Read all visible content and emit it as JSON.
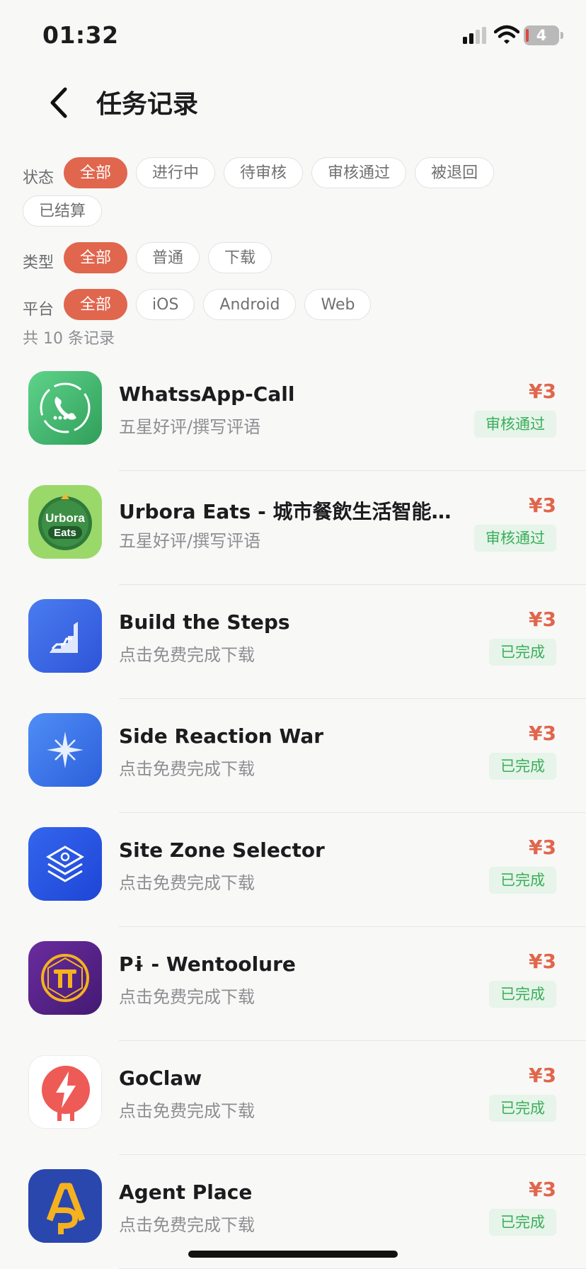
{
  "status_bar": {
    "time": "01:32",
    "battery": "4"
  },
  "nav": {
    "title": "任务记录"
  },
  "filters": {
    "status": {
      "label": "状态",
      "options": [
        "全部",
        "进行中",
        "待审核",
        "审核通过",
        "被退回",
        "已结算"
      ]
    },
    "type": {
      "label": "类型",
      "options": [
        "全部",
        "普通",
        "下载"
      ]
    },
    "platform": {
      "label": "平台",
      "options": [
        "全部",
        "iOS",
        "Android",
        "Web"
      ]
    }
  },
  "record_count": "共 10 条记录",
  "records": [
    {
      "name": "WhatssApp-Call",
      "subtitle": "五星好评/撰写评语",
      "price": "¥3",
      "status": "审核通过",
      "icon": "phone-call-icon"
    },
    {
      "name": "Urbora Eats - 城市餐飲生活智能助手",
      "subtitle": "五星好评/撰写评语",
      "price": "¥3",
      "status": "审核通过",
      "icon": "urbora-eats-logo-icon",
      "icon_text_1": "Urbora",
      "icon_text_2": "Eats"
    },
    {
      "name": "Build the Steps",
      "subtitle": "点击免费完成下载",
      "price": "¥3",
      "status": "已完成",
      "icon": "steps-icon"
    },
    {
      "name": "Side Reaction War",
      "subtitle": "点击免费完成下载",
      "price": "¥3",
      "status": "已完成",
      "icon": "star-cross-icon"
    },
    {
      "name": "Site Zone Selector",
      "subtitle": "点击免费完成下载",
      "price": "¥3",
      "status": "已完成",
      "icon": "layers-icon"
    },
    {
      "name": "Pɨ - Wentoolure",
      "subtitle": "点击免费完成下载",
      "price": "¥3",
      "status": "已完成",
      "icon": "pi-coin-icon"
    },
    {
      "name": "GoClaw",
      "subtitle": "点击免费完成下载",
      "price": "¥3",
      "status": "已完成",
      "icon": "lightning-icon"
    },
    {
      "name": "Agent Place",
      "subtitle": "点击免费完成下载",
      "price": "¥3",
      "status": "已完成",
      "icon": "ap-logo-icon"
    }
  ],
  "colors": {
    "accent": "#e0664d",
    "badge_text": "#3aae5a",
    "badge_bg": "#e6f4e9"
  }
}
